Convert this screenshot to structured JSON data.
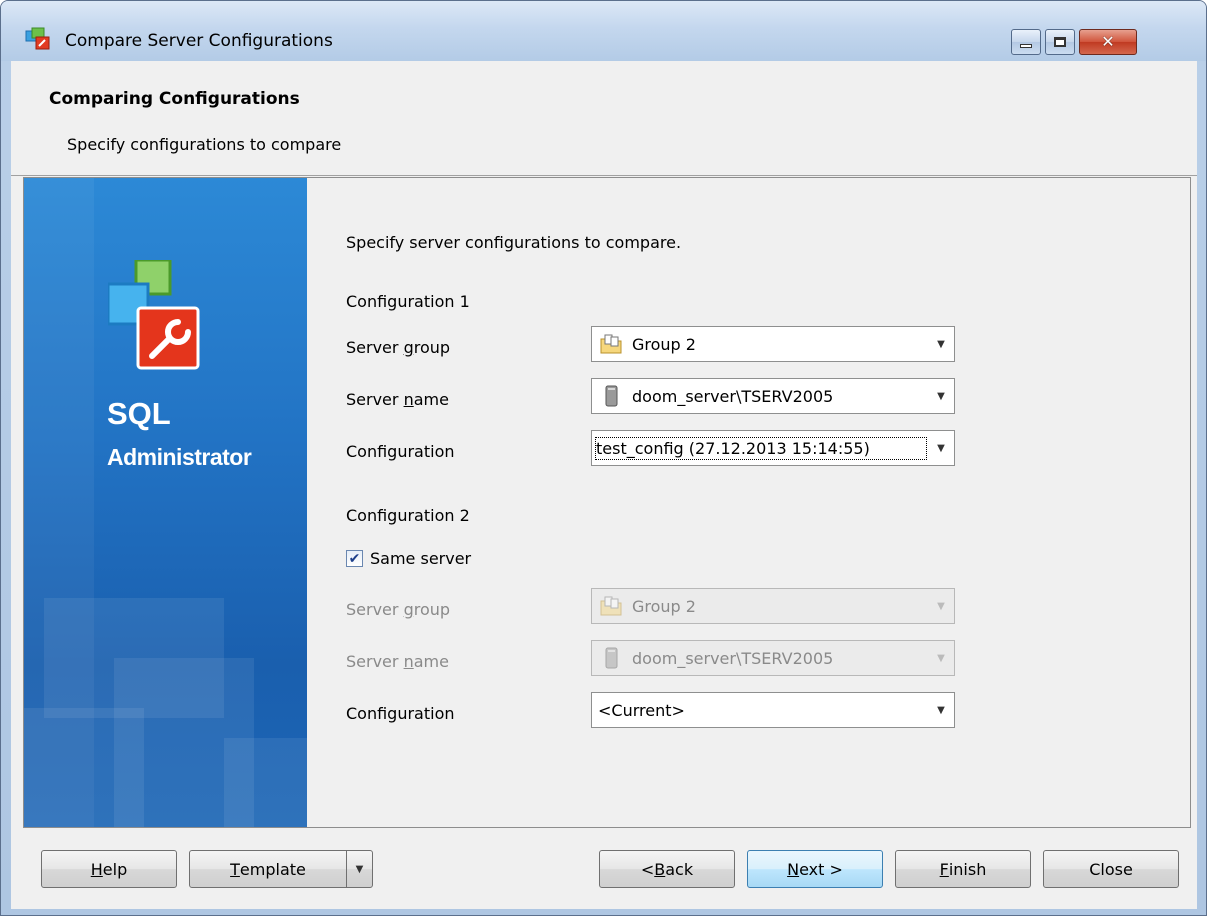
{
  "window": {
    "title": "Compare Server Configurations",
    "controls": {
      "minimize": "minimize",
      "maximize": "maximize",
      "close": "✕"
    }
  },
  "header": {
    "title": "Comparing Configurations",
    "subtitle": "Specify configurations to compare"
  },
  "banner": {
    "product_line1": "SQL",
    "product_line2": "Administrator"
  },
  "form": {
    "intro": "Specify server configurations to compare.",
    "config1": {
      "heading": "Configuration 1",
      "server_group_label_pre": "Server ",
      "server_group_label_u": "g",
      "server_group_label_post": "roup",
      "server_group_value": "Group 2",
      "server_name_label_pre": "Server ",
      "server_name_label_u": "n",
      "server_name_label_post": "ame",
      "server_name_value": "doom_server\\TSERV2005",
      "configuration_label": "Configuration",
      "configuration_value": "test_config (27.12.2013 15:14:55)"
    },
    "config2": {
      "heading": "Configuration 2",
      "same_server_label": "Same server",
      "same_server_checked": true,
      "server_group_label_pre": "Server ",
      "server_group_label_u": "g",
      "server_group_label_post": "roup",
      "server_group_value": "Group 2",
      "server_name_label_pre": "Server ",
      "server_name_label_u": "n",
      "server_name_label_post": "ame",
      "server_name_value": "doom_server\\TSERV2005",
      "configuration_label": "Configuration",
      "configuration_value": "<Current>"
    }
  },
  "buttons": {
    "help_u": "H",
    "help_rest": "elp",
    "template_u": "T",
    "template_rest": "emplate",
    "back_pre": "< ",
    "back_u": "B",
    "back_rest": "ack",
    "next_u": "N",
    "next_rest": "ext >",
    "finish_u": "F",
    "finish_rest": "inish",
    "close": "Close"
  },
  "icons": {
    "app": "compare-config-icon",
    "group": "folder-group-icon",
    "server": "server-icon",
    "dropdown": "chevron-down-icon"
  }
}
